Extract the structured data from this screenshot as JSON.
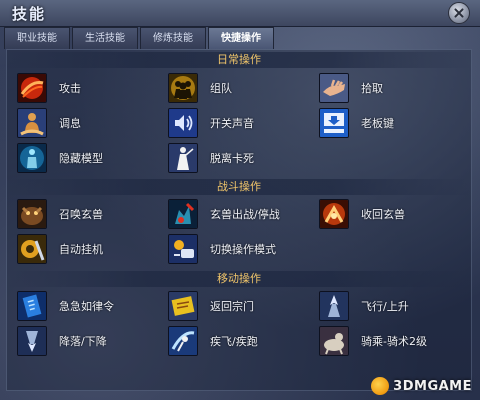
{
  "window": {
    "title": "技能"
  },
  "tabs": [
    {
      "label": "职业技能"
    },
    {
      "label": "生活技能"
    },
    {
      "label": "修炼技能"
    },
    {
      "label": "快捷操作",
      "active": true
    }
  ],
  "sections": [
    {
      "title": "日常操作",
      "rows": [
        [
          {
            "label": "攻击",
            "icon": "attack-icon"
          },
          {
            "label": "组队",
            "icon": "team-icon"
          },
          {
            "label": "拾取",
            "icon": "pickup-icon"
          }
        ],
        [
          {
            "label": "调息",
            "icon": "meditate-icon"
          },
          {
            "label": "开关声音",
            "icon": "sound-icon"
          },
          {
            "label": "老板键",
            "icon": "boss-key-icon"
          }
        ],
        [
          {
            "label": "隐藏模型",
            "icon": "hide-model-icon"
          },
          {
            "label": "脱离卡死",
            "icon": "unstuck-icon"
          }
        ]
      ]
    },
    {
      "title": "战斗操作",
      "rows": [
        [
          {
            "label": "召唤玄兽",
            "icon": "summon-pet-icon"
          },
          {
            "label": "玄兽出战/停战",
            "icon": "pet-battle-toggle-icon"
          },
          {
            "label": "收回玄兽",
            "icon": "recall-pet-icon"
          }
        ],
        [
          {
            "label": "自动挂机",
            "icon": "auto-battle-icon"
          },
          {
            "label": "切换操作模式",
            "icon": "switch-mode-icon"
          }
        ]
      ]
    },
    {
      "title": "移动操作",
      "rows": [
        [
          {
            "label": "急急如律令",
            "icon": "talisman-icon"
          },
          {
            "label": "返回宗门",
            "icon": "return-sect-icon"
          },
          {
            "label": "飞行/上升",
            "icon": "fly-up-icon"
          }
        ],
        [
          {
            "label": "降落/下降",
            "icon": "descend-icon"
          },
          {
            "label": "疾飞/疾跑",
            "icon": "sprint-icon"
          },
          {
            "label": "骑乘-骑术2级",
            "icon": "mount-icon"
          }
        ]
      ]
    }
  ],
  "watermark": {
    "text": "3DMGAME"
  },
  "colors": {
    "section_title": "#f0c56a",
    "label": "#f0f2f8",
    "active_tab": "#6b7894"
  }
}
